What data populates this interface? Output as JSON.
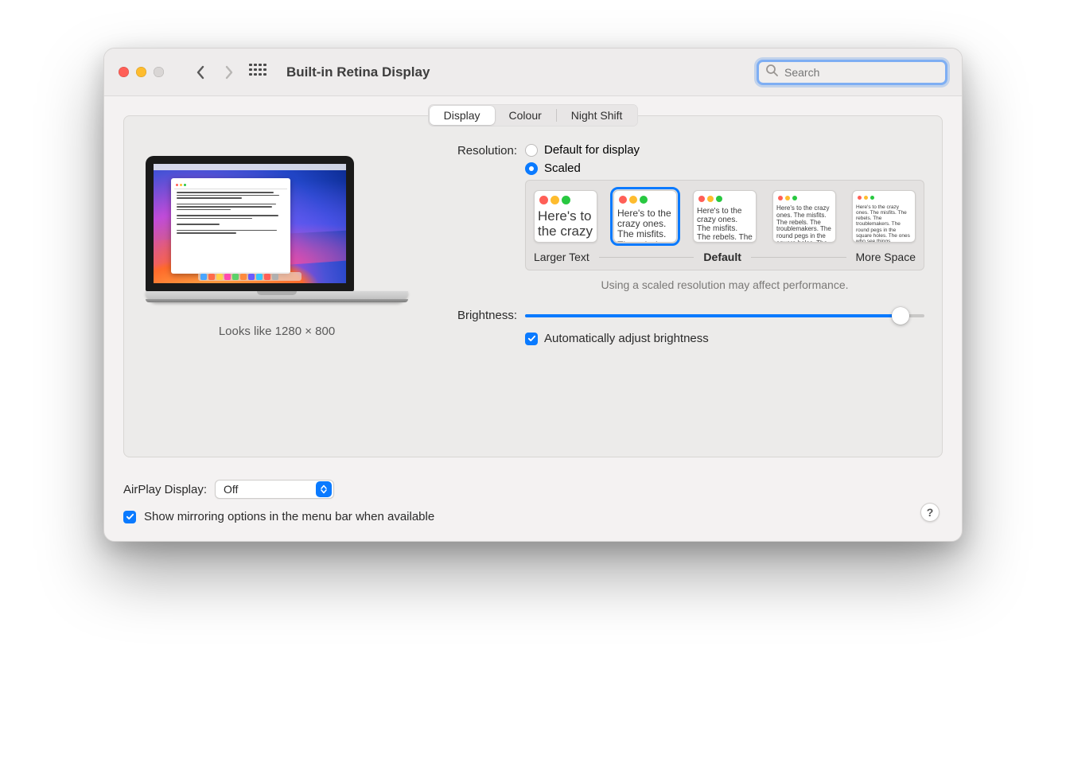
{
  "toolbar": {
    "title": "Built-in Retina Display",
    "search_placeholder": "Search"
  },
  "tabs": {
    "display": "Display",
    "colour": "Colour",
    "night_shift": "Night Shift",
    "active": "display"
  },
  "preview": {
    "looks_like": "Looks like 1280 × 800"
  },
  "resolution": {
    "label": "Resolution:",
    "options": {
      "default": "Default for display",
      "scaled": "Scaled"
    },
    "selected": "scaled",
    "thumbs": {
      "sample": "Here's to the crazy ones. The misfits. The rebels. The troublemakers. The round pegs in the square holes. The ones who see things differently. They're not fond of rules. And they have no respect for the status quo. You can quote them, disagree with them, glorify or vilify them. About the only thing you can't do is ignore them. Because they change things.",
      "selected_index": 1
    },
    "labels": {
      "larger": "Larger Text",
      "default": "Default",
      "more_space": "More Space"
    },
    "note": "Using a scaled resolution may affect performance."
  },
  "brightness": {
    "label": "Brightness:",
    "value_percent": 94,
    "auto_checked": true,
    "auto_label": "Automatically adjust brightness"
  },
  "airplay": {
    "label": "AirPlay Display:",
    "value": "Off"
  },
  "mirroring": {
    "checked": true,
    "label": "Show mirroring options in the menu bar when available"
  },
  "help": "?"
}
